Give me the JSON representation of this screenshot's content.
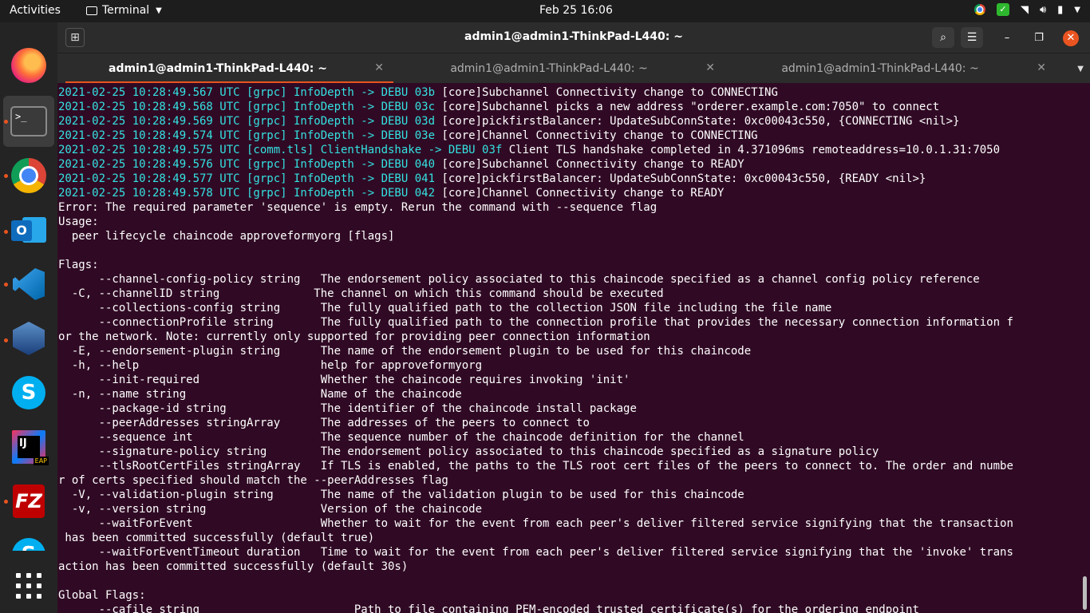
{
  "topbar": {
    "activities": "Activities",
    "app_name": "Terminal",
    "clock": "Feb 25  16:06"
  },
  "dock": {
    "items": [
      {
        "name": "firefox-icon"
      },
      {
        "name": "terminal-icon"
      },
      {
        "name": "chrome-icon"
      },
      {
        "name": "outlook-icon",
        "label": "O"
      },
      {
        "name": "vscode-icon"
      },
      {
        "name": "virtualbox-icon"
      },
      {
        "name": "skype-icon",
        "label": "S"
      },
      {
        "name": "intellij-icon",
        "label": "IJ",
        "badge": "EAP"
      },
      {
        "name": "filezilla-icon",
        "label": "FZ"
      },
      {
        "name": "skype-icon",
        "label": "S"
      },
      {
        "name": "show-applications-icon"
      }
    ],
    "accent_color": "#e95420"
  },
  "window": {
    "title": "admin1@admin1-ThinkPad-L440: ~",
    "tabs": [
      {
        "label": "admin1@admin1-ThinkPad-L440: ~",
        "active": true
      },
      {
        "label": "admin1@admin1-ThinkPad-L440: ~",
        "active": false
      },
      {
        "label": "admin1@admin1-ThinkPad-L440: ~",
        "active": false
      }
    ]
  },
  "terminal": {
    "background": "#300a24",
    "log_color": "#34e2e2",
    "lines": [
      {
        "prefix": "2021-02-25 10:28:49.567 UTC [grpc] InfoDepth -> DEBU 03b ",
        "text": "[core]Subchannel Connectivity change to CONNECTING"
      },
      {
        "prefix": "2021-02-25 10:28:49.568 UTC [grpc] InfoDepth -> DEBU 03c ",
        "text": "[core]Subchannel picks a new address \"orderer.example.com:7050\" to connect"
      },
      {
        "prefix": "2021-02-25 10:28:49.569 UTC [grpc] InfoDepth -> DEBU 03d ",
        "text": "[core]pickfirstBalancer: UpdateSubConnState: 0xc00043c550, {CONNECTING <nil>}"
      },
      {
        "prefix": "2021-02-25 10:28:49.574 UTC [grpc] InfoDepth -> DEBU 03e ",
        "text": "[core]Channel Connectivity change to CONNECTING"
      },
      {
        "prefix": "2021-02-25 10:28:49.575 UTC [comm.tls] ClientHandshake -> DEBU 03f ",
        "text": "Client TLS handshake completed in 4.371096ms remoteaddress=10.0.1.31:7050"
      },
      {
        "prefix": "2021-02-25 10:28:49.576 UTC [grpc] InfoDepth -> DEBU 040 ",
        "text": "[core]Subchannel Connectivity change to READY"
      },
      {
        "prefix": "2021-02-25 10:28:49.577 UTC [grpc] InfoDepth -> DEBU 041 ",
        "text": "[core]pickfirstBalancer: UpdateSubConnState: 0xc00043c550, {READY <nil>}"
      },
      {
        "prefix": "2021-02-25 10:28:49.578 UTC [grpc] InfoDepth -> DEBU 042 ",
        "text": "[core]Channel Connectivity change to READY"
      },
      {
        "prefix": "",
        "text": "Error: The required parameter 'sequence' is empty. Rerun the command with --sequence flag"
      },
      {
        "prefix": "",
        "text": "Usage:"
      },
      {
        "prefix": "",
        "text": "  peer lifecycle chaincode approveformyorg [flags]"
      },
      {
        "prefix": "",
        "text": ""
      },
      {
        "prefix": "",
        "text": "Flags:"
      },
      {
        "prefix": "",
        "text": "      --channel-config-policy string   The endorsement policy associated to this chaincode specified as a channel config policy reference"
      },
      {
        "prefix": "",
        "text": "  -C, --channelID string              The channel on which this command should be executed"
      },
      {
        "prefix": "",
        "text": "      --collections-config string      The fully qualified path to the collection JSON file including the file name"
      },
      {
        "prefix": "",
        "text": "      --connectionProfile string       The fully qualified path to the connection profile that provides the necessary connection information f"
      },
      {
        "prefix": "",
        "text": "or the network. Note: currently only supported for providing peer connection information"
      },
      {
        "prefix": "",
        "text": "  -E, --endorsement-plugin string      The name of the endorsement plugin to be used for this chaincode"
      },
      {
        "prefix": "",
        "text": "  -h, --help                           help for approveformyorg"
      },
      {
        "prefix": "",
        "text": "      --init-required                  Whether the chaincode requires invoking 'init'"
      },
      {
        "prefix": "",
        "text": "  -n, --name string                    Name of the chaincode"
      },
      {
        "prefix": "",
        "text": "      --package-id string              The identifier of the chaincode install package"
      },
      {
        "prefix": "",
        "text": "      --peerAddresses stringArray      The addresses of the peers to connect to"
      },
      {
        "prefix": "",
        "text": "      --sequence int                   The sequence number of the chaincode definition for the channel"
      },
      {
        "prefix": "",
        "text": "      --signature-policy string        The endorsement policy associated to this chaincode specified as a signature policy"
      },
      {
        "prefix": "",
        "text": "      --tlsRootCertFiles stringArray   If TLS is enabled, the paths to the TLS root cert files of the peers to connect to. The order and numbe"
      },
      {
        "prefix": "",
        "text": "r of certs specified should match the --peerAddresses flag"
      },
      {
        "prefix": "",
        "text": "  -V, --validation-plugin string       The name of the validation plugin to be used for this chaincode"
      },
      {
        "prefix": "",
        "text": "  -v, --version string                 Version of the chaincode"
      },
      {
        "prefix": "",
        "text": "      --waitForEvent                   Whether to wait for the event from each peer's deliver filtered service signifying that the transaction"
      },
      {
        "prefix": "",
        "text": " has been committed successfully (default true)"
      },
      {
        "prefix": "",
        "text": "      --waitForEventTimeout duration   Time to wait for the event from each peer's deliver filtered service signifying that the 'invoke' trans"
      },
      {
        "prefix": "",
        "text": "action has been committed successfully (default 30s)"
      },
      {
        "prefix": "",
        "text": ""
      },
      {
        "prefix": "",
        "text": "Global Flags:"
      },
      {
        "prefix": "",
        "text": "      --cafile string                       Path to file containing PEM-encoded trusted certificate(s) for the ordering endpoint"
      }
    ]
  }
}
